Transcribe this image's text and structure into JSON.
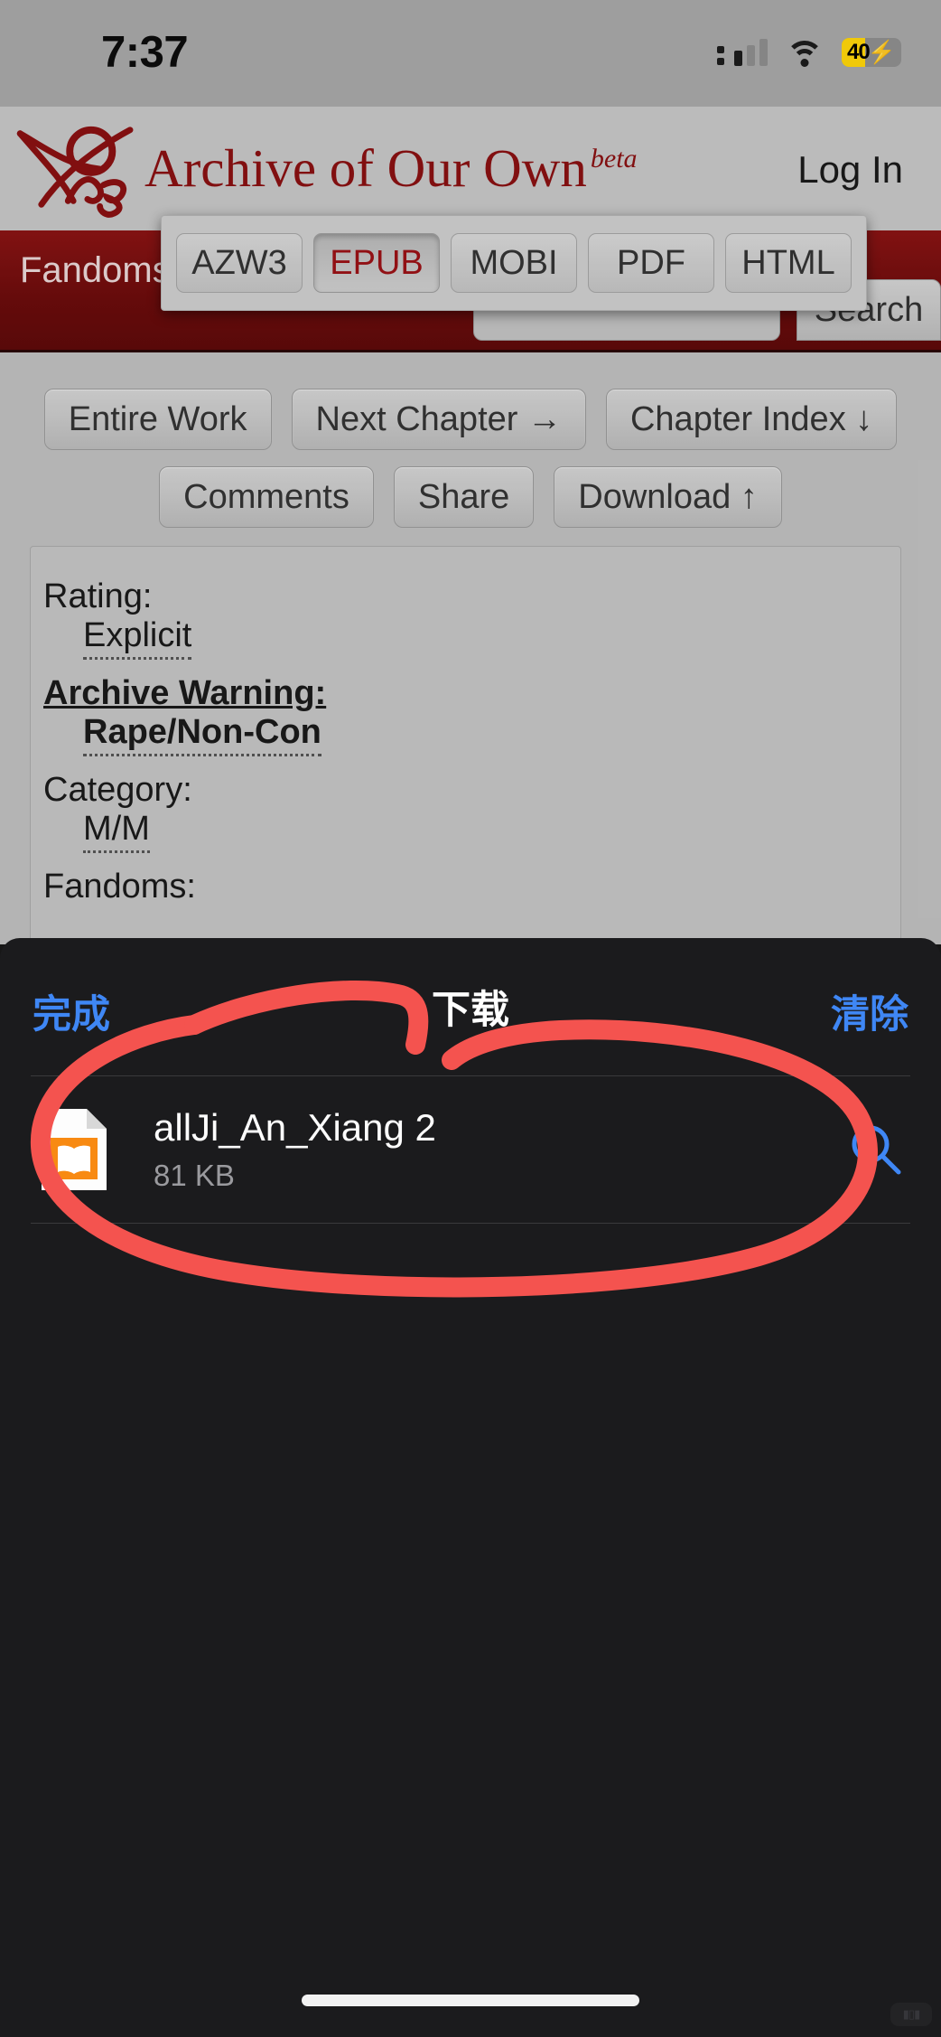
{
  "status_bar": {
    "time": "7:37",
    "battery_percent": "40",
    "battery_level": 40,
    "charging_glyph": "⚡",
    "wifi": "wifi-icon",
    "cellular": "cellular-signal-icon"
  },
  "browser_page": {
    "site_title": "Archive of Our Own",
    "site_beta": "beta",
    "login_label": "Log In",
    "nav": {
      "fandoms_label": "Fandoms",
      "search_value": "",
      "search_placeholder": "",
      "search_button_label": "Search"
    },
    "download_formats": {
      "options": [
        "AZW3",
        "EPUB",
        "MOBI",
        "PDF",
        "HTML"
      ],
      "selected": "EPUB",
      "selected_color": "#9b1216"
    },
    "work_actions_row1": [
      "Entire Work",
      "Next Chapter →",
      "Chapter Index ↓"
    ],
    "work_actions_row2": [
      "Comments",
      "Share",
      "Download ↑"
    ],
    "work_meta": [
      {
        "label": "Rating:",
        "value": "Explicit",
        "bold": false
      },
      {
        "label": "Archive Warning:",
        "value": "Rape/Non-Con",
        "bold": true
      },
      {
        "label": "Category:",
        "value": "M/M",
        "bold": false
      },
      {
        "label": "Fandoms:",
        "value": "",
        "bold": false
      }
    ],
    "nav_bar_color": "#6d0c0c",
    "brand_color": "#8a1012"
  },
  "downloads_sheet": {
    "done_label": "完成",
    "title": "下载",
    "clear_label": "清除",
    "accent_color": "#3f87f5",
    "items": [
      {
        "file_name": "allJi_An_Xiang 2",
        "file_size": "81 KB",
        "file_icon": "epub-document-icon",
        "action_icon": "search-icon"
      }
    ]
  },
  "annotation": {
    "type": "hand-drawn-ellipse",
    "color": "#f4534f",
    "targets": "downloaded-file-row"
  }
}
